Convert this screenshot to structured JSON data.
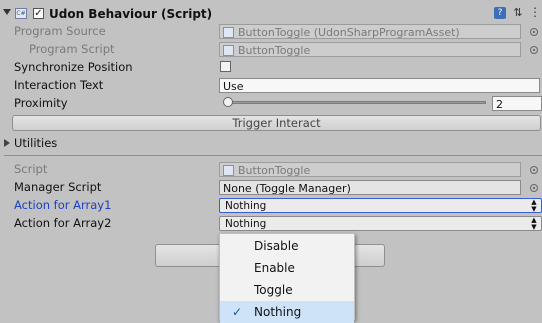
{
  "component": {
    "title": "Udon Behaviour (Script)",
    "enabled": true
  },
  "fields": {
    "program_source": {
      "label": "Program Source",
      "value": "ButtonToggle (UdonSharpProgramAsset)"
    },
    "program_script": {
      "label": "Program Script",
      "value": "ButtonToggle"
    },
    "sync_position": {
      "label": "Synchronize Position",
      "checked": false
    },
    "interaction_text": {
      "label": "Interaction Text",
      "value": "Use"
    },
    "proximity": {
      "label": "Proximity",
      "value": "2",
      "slider_fraction": 0.0
    },
    "trigger_interact": {
      "label": "Trigger Interact"
    },
    "utilities": {
      "label": "Utilities",
      "expanded": false
    },
    "script": {
      "label": "Script",
      "value": "ButtonToggle"
    },
    "manager_script": {
      "label": "Manager Script",
      "value": "None (Toggle Manager)"
    },
    "action_array1": {
      "label": "Action for Array1",
      "value": "Nothing"
    },
    "action_array2": {
      "label": "Action for Array2",
      "value": "Nothing"
    }
  },
  "dropdown": {
    "options": [
      "Disable",
      "Enable",
      "Toggle",
      "Nothing"
    ],
    "selected": "Nothing",
    "check_glyph": "✓"
  },
  "colors": {
    "background": "#c2c2c2",
    "active_label": "#1d3fc4",
    "selected_option": "#cfe3f8"
  }
}
